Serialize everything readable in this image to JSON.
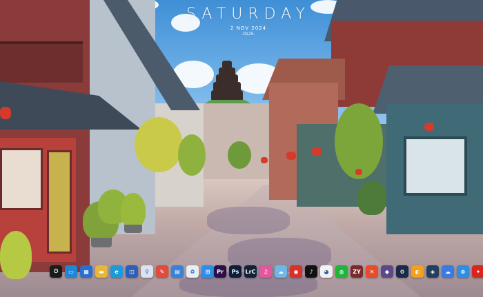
{
  "overlay": {
    "day": "SATURDAY",
    "date": "2 NOV 2024",
    "day_of_year": "-0125-"
  },
  "dock": {
    "system_icons": [
      {
        "name": "power-icon",
        "glyph": "⏻",
        "bg": "#1b1b1b"
      },
      {
        "name": "monitor-icon",
        "glyph": "▭",
        "bg": "#1f86d6"
      },
      {
        "name": "control-panel-icon",
        "glyph": "▦",
        "bg": "#2a6fd0"
      },
      {
        "name": "file-explorer-icon",
        "glyph": "▬",
        "bg": "#e8b63a"
      },
      {
        "name": "edge-browser-icon",
        "glyph": "e",
        "bg": "#1c9bd8"
      },
      {
        "name": "store-icon",
        "glyph": "◫",
        "bg": "#2b5fb8"
      },
      {
        "name": "search-icon",
        "glyph": "⚲",
        "bg": "#d9e4f0"
      },
      {
        "name": "paint-icon",
        "glyph": "✎",
        "bg": "#e04b3a"
      },
      {
        "name": "calculator-icon",
        "glyph": "▤",
        "bg": "#3a82d8"
      },
      {
        "name": "recycle-bin-icon",
        "glyph": "♻",
        "bg": "#e6eef6"
      },
      {
        "name": "windows-start-icon",
        "glyph": "⊞",
        "bg": "#2f8ee8"
      }
    ],
    "app_icons": [
      {
        "name": "premiere-pro-icon",
        "glyph": "Pr",
        "bg": "#2a0f4a"
      },
      {
        "name": "photoshop-icon",
        "glyph": "Ps",
        "bg": "#0b1e3a"
      },
      {
        "name": "lightroom-classic-icon",
        "glyph": "LrC",
        "bg": "#0f2236"
      },
      {
        "name": "music-app-icon",
        "glyph": "♫",
        "bg": "#e2589c"
      },
      {
        "name": "weather-app-icon",
        "glyph": "☁",
        "bg": "#6fb7e6"
      },
      {
        "name": "netease-music-icon",
        "glyph": "◉",
        "bg": "#d8302b"
      },
      {
        "name": "tiktok-icon",
        "glyph": "♪",
        "bg": "#111111"
      },
      {
        "name": "qq-icon",
        "glyph": "◕",
        "bg": "#f2f2f2"
      },
      {
        "name": "wechat-icon",
        "glyph": "◍",
        "bg": "#20b53a"
      },
      {
        "name": "zy-player-icon",
        "glyph": "ZY",
        "bg": "#7a2b2b"
      },
      {
        "name": "xmind-icon",
        "glyph": "✕",
        "bg": "#e84c2b"
      },
      {
        "name": "game-icon",
        "glyph": "◆",
        "bg": "#5a4a8a"
      },
      {
        "name": "steam-icon",
        "glyph": "⚙",
        "bg": "#1a2a44"
      },
      {
        "name": "downloader-icon",
        "glyph": "◐",
        "bg": "#f2a020"
      },
      {
        "name": "clash-icon",
        "glyph": "◈",
        "bg": "#22405e"
      },
      {
        "name": "cloud-drive-icon",
        "glyph": "☁",
        "bg": "#3a7be0"
      },
      {
        "name": "baidu-netdisk-icon",
        "glyph": "⊚",
        "bg": "#2f8de4"
      },
      {
        "name": "pdf-reader-icon",
        "glyph": "✦",
        "bg": "#d8261f"
      }
    ]
  }
}
